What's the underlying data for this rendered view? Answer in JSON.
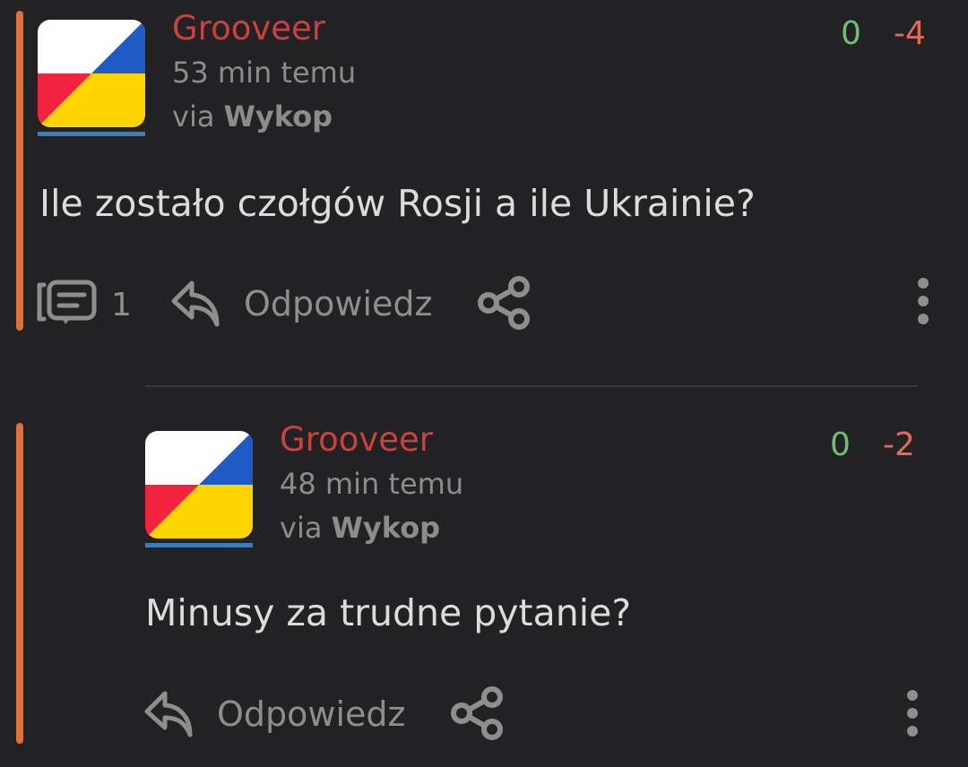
{
  "colors": {
    "background": "#222224",
    "accent_bar": "#e0703a",
    "username": "#c9423f",
    "vote_plus": "#6cc070",
    "vote_minus": "#e26a5d",
    "muted": "#8e8e8e",
    "flag_white": "#ffffff",
    "flag_red": "#f2233f",
    "flag_blue": "#1e5bc6",
    "flag_yellow": "#ffd400"
  },
  "entry": {
    "username": "Grooveer",
    "time": "53 min temu",
    "via_prefix": "via",
    "via_app": "Wykop",
    "votes_plus": "0",
    "votes_minus": "-4",
    "text": "Ile zostało czołgów Rosji a ile Ukrainie?",
    "comments_count": "1",
    "reply_label": "Odpowiedz",
    "icons": [
      "comments-icon",
      "reply-icon",
      "share-icon",
      "more-vertical-icon"
    ]
  },
  "comment": {
    "username": "Grooveer",
    "time": "48 min temu",
    "via_prefix": "via",
    "via_app": "Wykop",
    "votes_plus": "0",
    "votes_minus": "-2",
    "text": "Minusy za trudne pytanie?",
    "reply_label": "Odpowiedz",
    "icons": [
      "reply-icon",
      "share-icon",
      "more-vertical-icon"
    ]
  }
}
